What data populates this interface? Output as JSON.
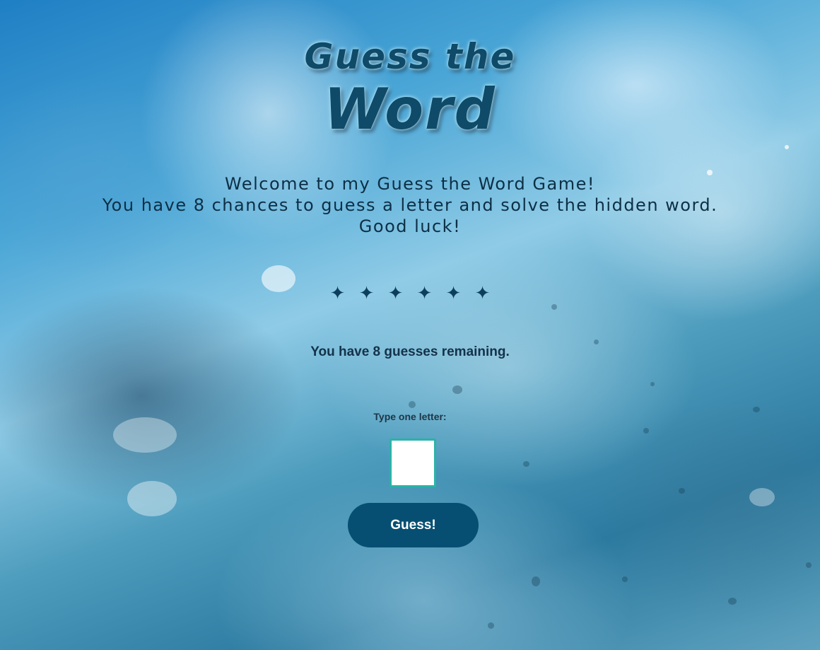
{
  "title": {
    "line1": "Guess the",
    "line2": "Word"
  },
  "intro": {
    "line1": "Welcome to my Guess the Word Game!",
    "line2": "You have 8 chances to guess a letter and solve the hidden word.",
    "line3": "Good luck!"
  },
  "word_progress": {
    "placeholders": [
      "✦",
      "✦",
      "✦",
      "✦",
      "✦",
      "✦"
    ]
  },
  "status": {
    "remaining_text": "You have 8 guesses remaining."
  },
  "guess_form": {
    "label": "Type one letter:",
    "input_value": "",
    "button_label": "Guess!"
  },
  "colors": {
    "button_bg": "#064f72",
    "input_border": "#2ab3a8",
    "title_text": "#0f4a68"
  }
}
